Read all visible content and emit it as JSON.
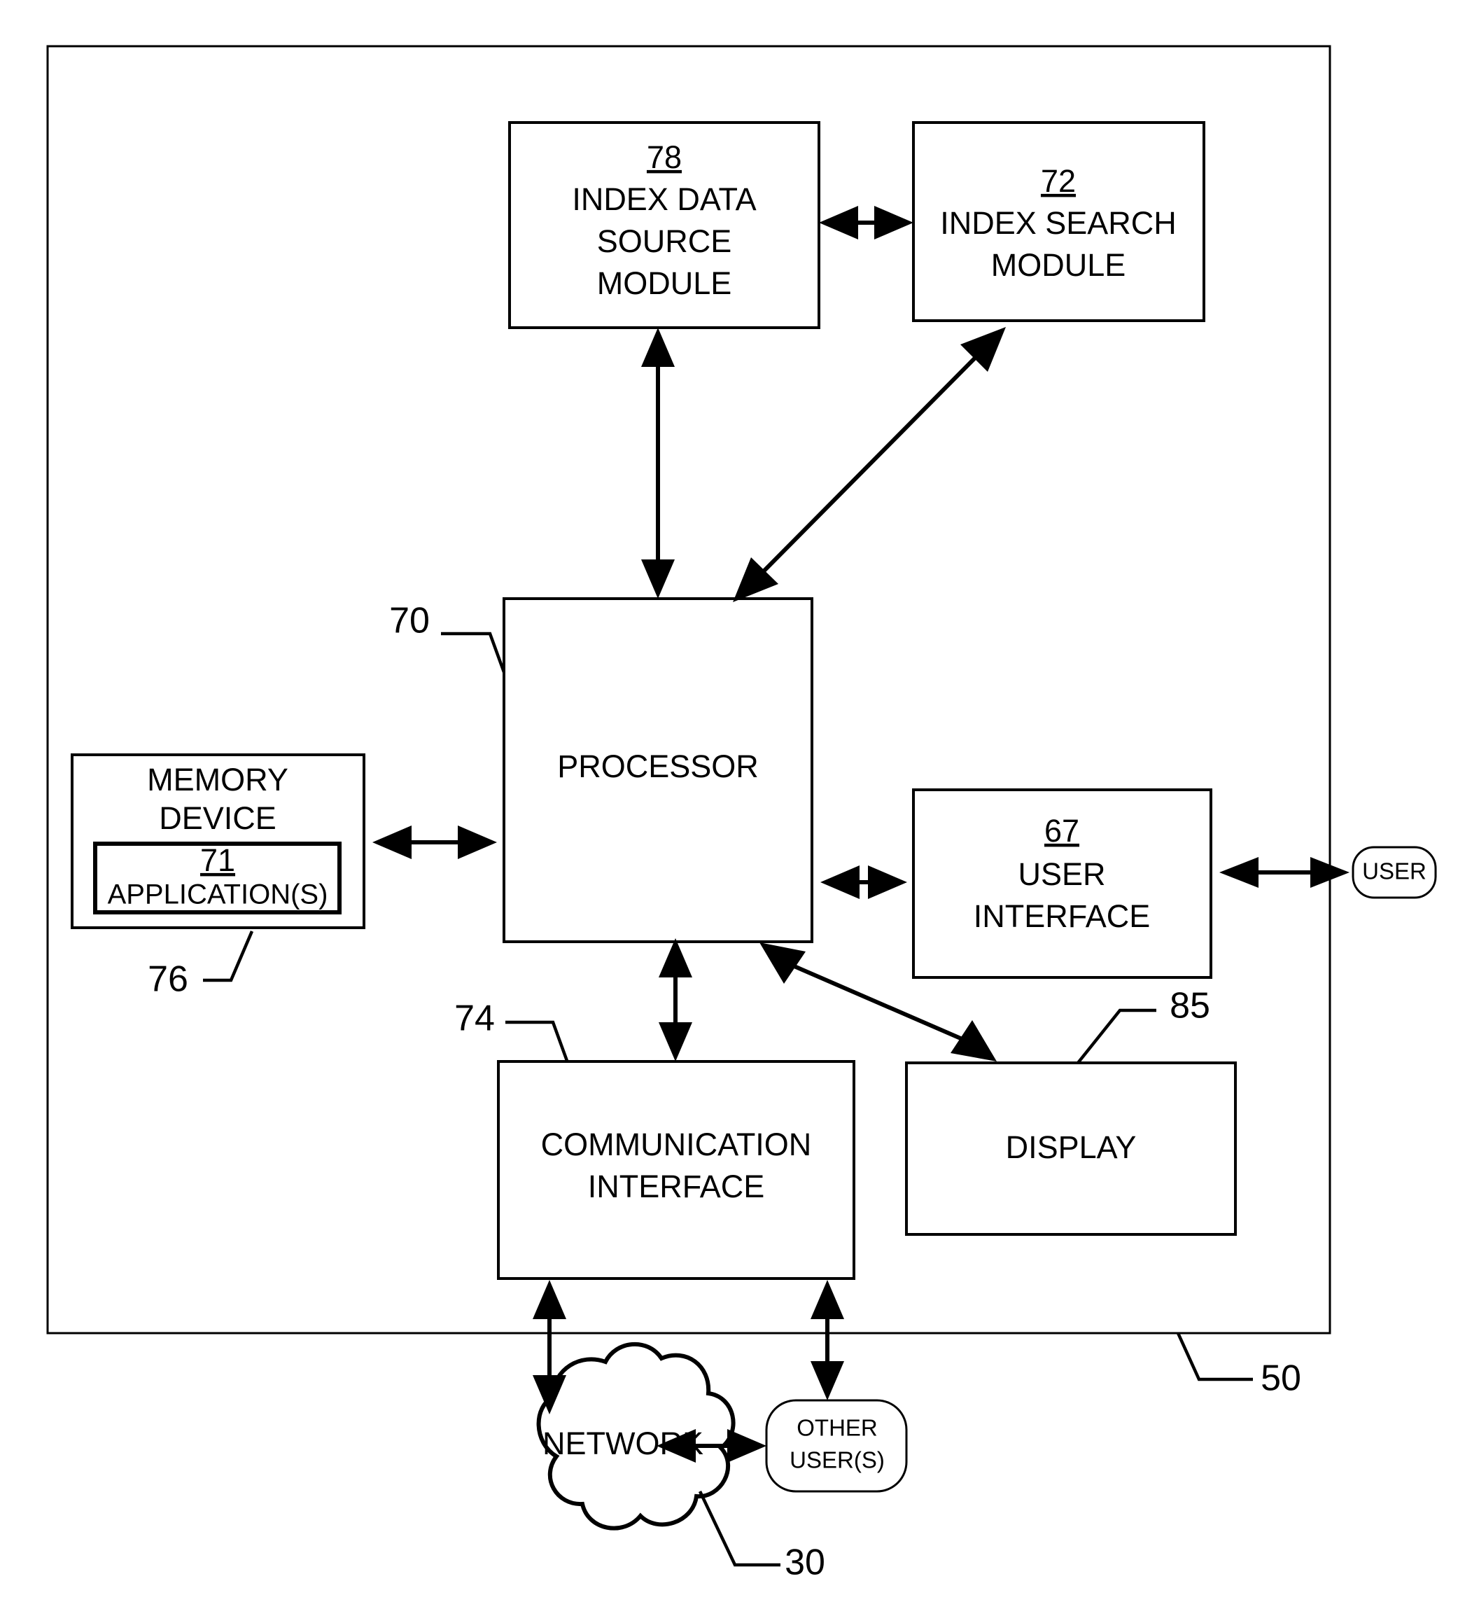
{
  "figure": {
    "type": "block-diagram",
    "style": "patent-line-drawing",
    "background": "#ffffff",
    "line_color": "#000000"
  },
  "outer_boundary": {
    "label": "50",
    "name": "apparatus-boundary"
  },
  "blocks": {
    "index_data_source": {
      "ref": "78",
      "lines": [
        "INDEX DATA",
        "SOURCE",
        "MODULE"
      ],
      "line1": "INDEX DATA",
      "line2": "SOURCE",
      "line3": "MODULE"
    },
    "index_search": {
      "ref": "72",
      "line1": "INDEX SEARCH",
      "line2": "MODULE"
    },
    "processor": {
      "ref": "70",
      "label": "PROCESSOR"
    },
    "memory_device": {
      "ref": "76",
      "line1": "MEMORY",
      "line2": "DEVICE"
    },
    "applications": {
      "ref": "71",
      "label": "APPLICATION(S)"
    },
    "user_interface": {
      "ref": "67",
      "line1": "USER",
      "line2": "INTERFACE"
    },
    "display": {
      "ref": "85",
      "label": "DISPLAY"
    },
    "communication_interface": {
      "ref": "74",
      "line1": "COMMUNICATION",
      "line2": "INTERFACE"
    },
    "user": {
      "label": "USER"
    },
    "network": {
      "ref": "30",
      "label": "NETWORK"
    },
    "other_users": {
      "line1": "OTHER",
      "line2": "USER(S)"
    }
  },
  "connections": [
    {
      "from": "index_data_source",
      "to": "index_search",
      "arrow": "double"
    },
    {
      "from": "processor",
      "to": "index_data_source",
      "arrow": "double"
    },
    {
      "from": "processor",
      "to": "index_search",
      "arrow": "double"
    },
    {
      "from": "memory_device",
      "to": "processor",
      "arrow": "double"
    },
    {
      "from": "processor",
      "to": "user_interface",
      "arrow": "double"
    },
    {
      "from": "user_interface",
      "to": "user",
      "arrow": "double"
    },
    {
      "from": "processor",
      "to": "display",
      "arrow": "double"
    },
    {
      "from": "processor",
      "to": "communication_interface",
      "arrow": "double"
    },
    {
      "from": "communication_interface",
      "to": "network",
      "arrow": "double"
    },
    {
      "from": "communication_interface",
      "to": "other_users",
      "arrow": "double"
    },
    {
      "from": "network",
      "to": "other_users",
      "arrow": "double"
    }
  ]
}
